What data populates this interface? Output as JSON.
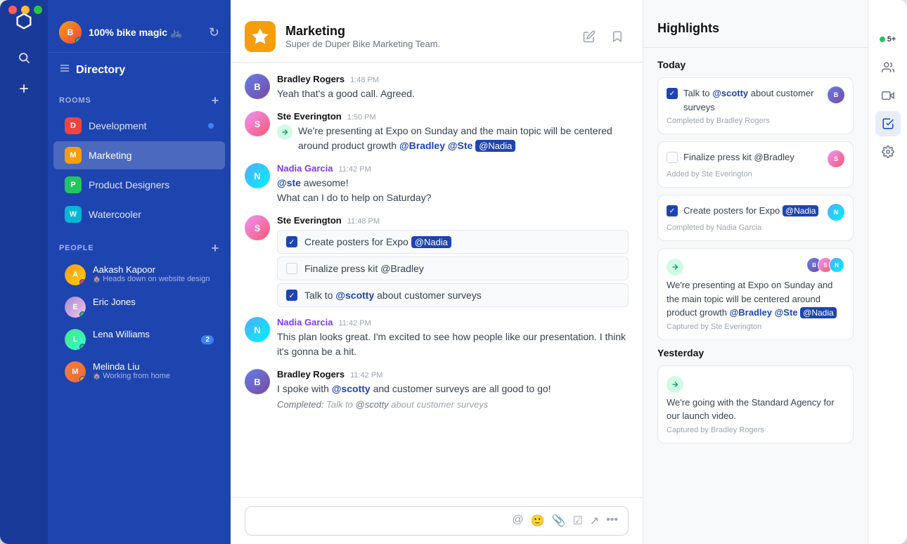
{
  "window": {
    "title": "Twist"
  },
  "titlebar": {
    "controls": [
      "close",
      "minimize",
      "maximize"
    ]
  },
  "iconbar": {
    "logo_label": "Twist logo",
    "search_label": "search",
    "add_label": "add",
    "bottom_items": [
      {
        "name": "people-icon",
        "glyph": "👥"
      },
      {
        "name": "video-icon",
        "glyph": "📹"
      },
      {
        "name": "tasks-icon",
        "glyph": "☑"
      },
      {
        "name": "settings-icon",
        "glyph": "⚙"
      }
    ]
  },
  "sidebar": {
    "user": {
      "name": "100% bike magic 🚲",
      "avatar_initial": "B"
    },
    "directory_label": "Directory",
    "rooms_section": "ROOMS",
    "rooms": [
      {
        "id": "development",
        "name": "Development",
        "has_dot": true,
        "icon_color": "#ef4444",
        "icon_label": "D"
      },
      {
        "id": "marketing",
        "name": "Marketing",
        "has_dot": false,
        "active": true,
        "icon_color": "#f59e0b",
        "icon_label": "M"
      },
      {
        "id": "product-designers",
        "name": "Product Designers",
        "has_dot": false,
        "icon_color": "#22c55e",
        "icon_label": "P"
      },
      {
        "id": "watercooler",
        "name": "Watercooler",
        "has_dot": false,
        "icon_color": "#06b6d4",
        "icon_label": "W"
      }
    ],
    "people_section": "PEOPLE",
    "people": [
      {
        "id": "aakash",
        "name": "Aakash Kapoor",
        "status": "Heads down on website design",
        "status_color": "busy",
        "badge": null
      },
      {
        "id": "eric",
        "name": "Eric Jones",
        "status": "",
        "status_color": "online",
        "badge": null
      },
      {
        "id": "lena",
        "name": "Lena Williams",
        "status": "",
        "status_color": "online",
        "badge": "2"
      },
      {
        "id": "melinda",
        "name": "Melinda Liu",
        "status": "Working from home",
        "status_color": "away",
        "badge": null
      }
    ]
  },
  "chat": {
    "room_name": "Marketing",
    "room_desc": "Super de Duper Bike Marketing Team.",
    "messages": [
      {
        "id": 1,
        "author": "Bradley Rogers",
        "author_type": "bradley",
        "time": "1:48 PM",
        "text": "Yeah that's a good call. Agreed.",
        "type": "text"
      },
      {
        "id": 2,
        "author": "Ste Everington",
        "author_type": "ste",
        "time": "1:50 PM",
        "text": "We're presenting at Expo on Sunday and the main topic will be centered around product growth",
        "mentions": [
          "@Bradley",
          "@Ste",
          "@Nadia"
        ],
        "type": "message-with-mentions",
        "icon_type": "sling"
      },
      {
        "id": 3,
        "author": "Nadia Garcia",
        "author_type": "nadia",
        "time": "11:42 PM",
        "lines": [
          "@ste  awesome!",
          "What can I do to help on Saturday?"
        ],
        "type": "nadia-text"
      },
      {
        "id": 4,
        "author": "Ste Everington",
        "author_type": "ste",
        "time": "11:48 PM",
        "type": "tasks",
        "tasks": [
          {
            "text": "Create posters for Expo",
            "mention": "@Nadia",
            "checked": true
          },
          {
            "text": "Finalize press kit @Bradley",
            "checked": false
          },
          {
            "text": "Talk to",
            "mention2": "@scotty",
            "text2": "about customer surveys",
            "checked": true
          }
        ]
      },
      {
        "id": 5,
        "author": "Nadia Garcia",
        "author_type": "nadia",
        "time": "11:42 PM",
        "text": "This plan looks great. I'm excited to see how people like our presentation. I think it's gonna be a hit.",
        "type": "text"
      },
      {
        "id": 6,
        "author": "Bradley Rogers",
        "author_type": "bradley",
        "time": "11:42 PM",
        "text": "I spoke with @scotty and customer surveys are all good to go!",
        "completed_label": "Completed:",
        "completed_text": "Talk to @scotty about customer surveys",
        "type": "text-with-completed"
      }
    ],
    "input_placeholder": ""
  },
  "highlights": {
    "title": "Highlights",
    "online_count": "5+",
    "today_label": "Today",
    "items": [
      {
        "id": 1,
        "checked": true,
        "text": "Talk to @scotty about customer surveys",
        "meta": "Completed by Bradley Rogers",
        "avatar_initial": "B",
        "avatar_type": "bradley"
      },
      {
        "id": 2,
        "checked": false,
        "text": "Finalize press kit @Bradley",
        "meta": "Added by Ste Everington",
        "avatar_initial": "S",
        "avatar_type": "ste"
      },
      {
        "id": 3,
        "checked": true,
        "text": "Create posters for Expo @Nadia",
        "meta": "Completed by Nadia Garcia",
        "avatar_initial": "N",
        "avatar_type": "nadia",
        "mention": "@Nadia"
      },
      {
        "id": 4,
        "type": "message",
        "text": "We're presenting at Expo on Sunday and the main topic will be centered around product growth",
        "mentions": [
          "@Bradley",
          "@Ste",
          "@Nadia"
        ],
        "meta": "Captured by Ste Everington",
        "multiple_avatars": true
      }
    ],
    "yesterday_label": "Yesterday",
    "yesterday_items": [
      {
        "id": 5,
        "type": "message",
        "text": "We're going with the Standard Agency for our launch video.",
        "meta": "Captured by Bradley Rogers"
      }
    ]
  },
  "far_right": {
    "items": [
      {
        "name": "people-panel-icon",
        "glyph": "👥",
        "active": false,
        "has_badge": true,
        "badge_value": "5+"
      },
      {
        "name": "video-panel-icon",
        "glyph": "📹",
        "active": false
      },
      {
        "name": "tasks-panel-icon",
        "glyph": "☑",
        "active": true
      },
      {
        "name": "settings-panel-icon",
        "glyph": "⚙",
        "active": false
      }
    ]
  }
}
